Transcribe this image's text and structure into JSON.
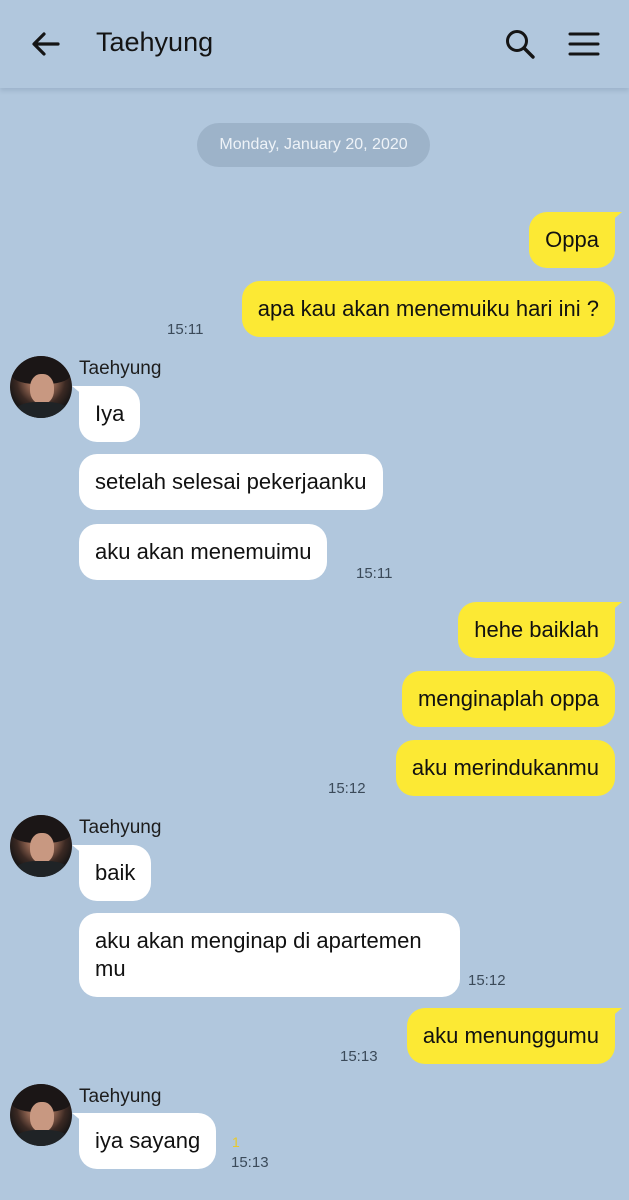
{
  "header": {
    "title": "Taehyung",
    "back_icon": "arrow-left-icon",
    "search_icon": "search-icon",
    "menu_icon": "hamburger-menu-icon"
  },
  "date_divider": "Monday, January 20, 2020",
  "colors": {
    "background": "#b1c7dd",
    "my_bubble": "#fce934",
    "their_bubble": "#ffffff",
    "date_pill": "#9db3c9"
  },
  "messages": [
    {
      "from": "me",
      "text": "Oppa"
    },
    {
      "from": "me",
      "text": "apa kau akan menemuiku hari ini ?",
      "time": "15:11"
    },
    {
      "from": "Taehyung",
      "sender_label": "Taehyung",
      "text": "Iya"
    },
    {
      "from": "Taehyung",
      "text": "setelah selesai pekerjaanku"
    },
    {
      "from": "Taehyung",
      "text": "aku akan menemuimu",
      "time": "15:11"
    },
    {
      "from": "me",
      "text": "hehe baiklah"
    },
    {
      "from": "me",
      "text": "menginaplah oppa"
    },
    {
      "from": "me",
      "text": "aku merindukanmu",
      "time": "15:12"
    },
    {
      "from": "Taehyung",
      "sender_label": "Taehyung",
      "text": "baik"
    },
    {
      "from": "Taehyung",
      "text": "aku akan menginap di apartemen mu",
      "time": "15:12"
    },
    {
      "from": "me",
      "text": "aku menunggumu",
      "time": "15:13"
    },
    {
      "from": "Taehyung",
      "sender_label": "Taehyung",
      "text": "iya sayang",
      "unread": "1",
      "time": "15:13"
    }
  ]
}
